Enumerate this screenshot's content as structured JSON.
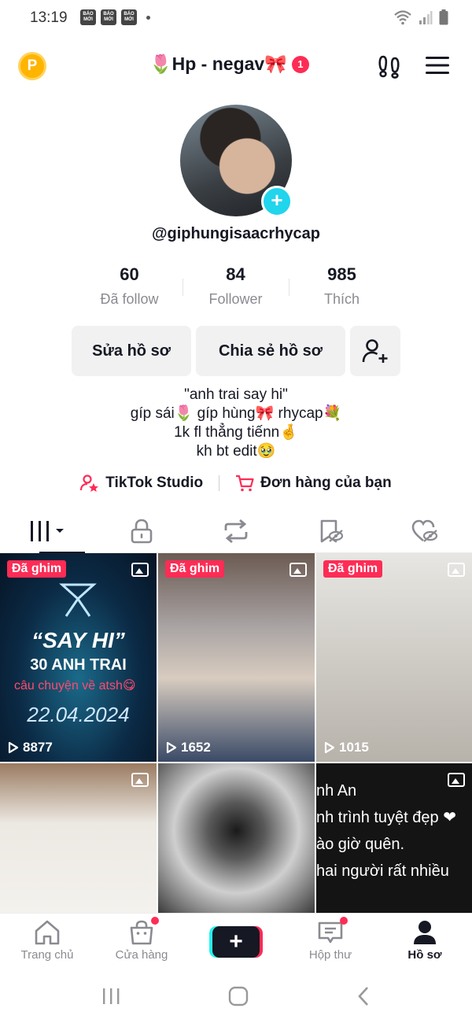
{
  "status_bar": {
    "time": "13:19",
    "notif_icon_text": "BÁO MỚI"
  },
  "header": {
    "account_name": "🌷Hp - negav🎀",
    "account_badge": "1",
    "coin_label": "P"
  },
  "profile": {
    "username": "@giphungisaacrhycap",
    "stats": [
      {
        "value": "60",
        "label": "Đã follow"
      },
      {
        "value": "84",
        "label": "Follower"
      },
      {
        "value": "985",
        "label": "Thích"
      }
    ],
    "edit_button": "Sửa hồ sơ",
    "share_button": "Chia sẻ hồ sơ",
    "bio": [
      "\"anh trai say hi\"",
      "gíp sái🌷 gíp hùng🎀 rhycap💐",
      "1k fl thẳng tiếnn🤞",
      "kh bt edit🥹"
    ],
    "links": {
      "studio": "TikTok Studio",
      "orders": "Đơn hàng của bạn"
    }
  },
  "grid": {
    "pinned_label": "Đã ghim",
    "items": [
      {
        "views": "8877",
        "title": "“SAY HI”",
        "subtitle": "30 ANH TRAI",
        "caption": "câu chuyện về atsh😋",
        "date": "22.04.2024"
      },
      {
        "views": "1652"
      },
      {
        "views": "1015"
      },
      {
        "views": ""
      },
      {
        "views": ""
      },
      {
        "text": "nh An\nnh trình tuyệt đẹp ❤\nào giờ quên.\nhai người rất nhiều"
      }
    ]
  },
  "bottom_nav": {
    "items": [
      {
        "label": "Trang chủ"
      },
      {
        "label": "Cửa hàng"
      },
      {
        "label": "+"
      },
      {
        "label": "Hộp thư"
      },
      {
        "label": "Hồ sơ"
      }
    ]
  },
  "colors": {
    "accent": "#fe2c55",
    "cyan": "#20d5ec",
    "text": "#161823",
    "muted": "#8a8b91"
  }
}
